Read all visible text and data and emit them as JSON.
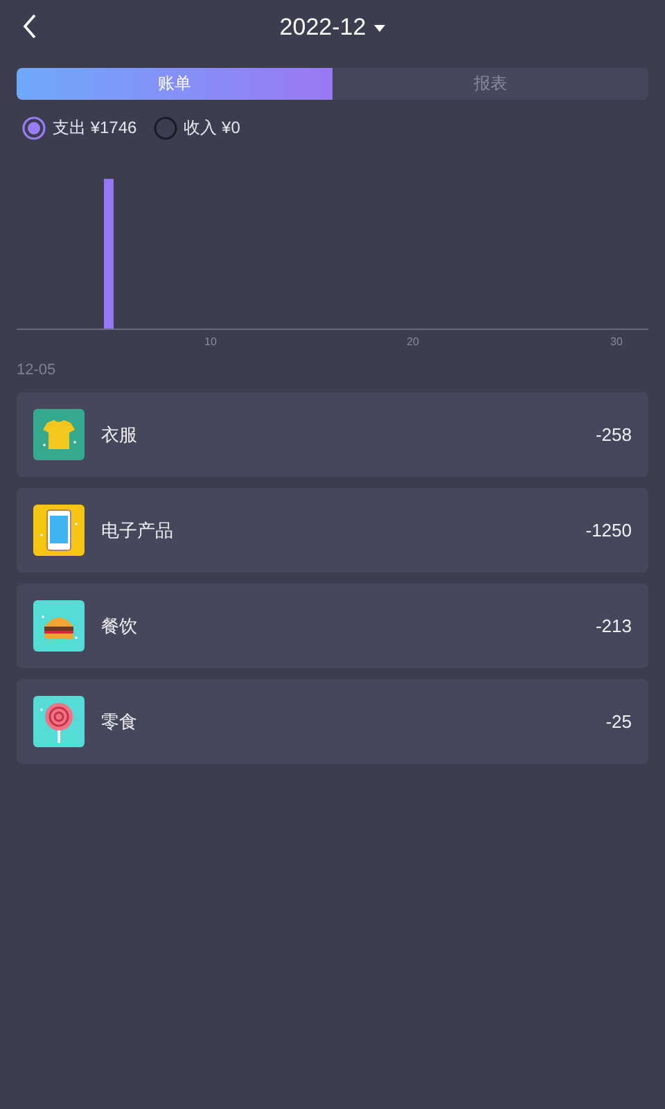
{
  "header": {
    "title": "2022-12"
  },
  "tabs": [
    {
      "label": "账单",
      "selected": true
    },
    {
      "label": "报表",
      "selected": false
    }
  ],
  "filters": [
    {
      "label": "支出 ¥1746",
      "selected": true
    },
    {
      "label": "收入 ¥0",
      "selected": false
    }
  ],
  "chart": {
    "x_labels": [
      "10",
      "20",
      "30"
    ]
  },
  "date": "12-05",
  "records": [
    {
      "name": "衣服",
      "amount": "-258"
    },
    {
      "name": "电子产品",
      "amount": "-1250"
    },
    {
      "name": "餐饮",
      "amount": "-213"
    },
    {
      "name": "零食",
      "amount": "-25"
    }
  ]
}
